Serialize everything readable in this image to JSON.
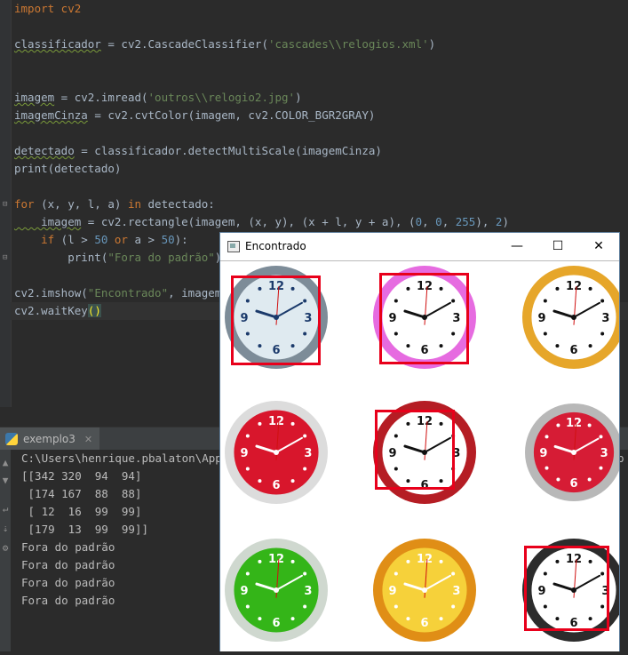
{
  "editor": {
    "line_import": "import cv2",
    "line_classifier_a": "classificador",
    "line_classifier_b": " = cv2.CascadeClassifier(",
    "line_classifier_str": "'cascades\\\\relogios.xml'",
    "line_classifier_c": ")",
    "line_imagem_a": "imagem",
    "line_imagem_b": " = cv2.imread(",
    "line_imagem_str": "'outros\\\\relogio2.jpg'",
    "line_imagem_c": ")",
    "line_cinza_a": "imagemCinza",
    "line_cinza_b": " = cv2.cvtColor(imagem, cv2.COLOR_BGR2GRAY)",
    "line_detect_a": "detectado",
    "line_detect_b": " = classificador.detectMultiScale(imagemCinza)",
    "line_print": "print(detectado)",
    "line_for_kw": "for",
    "line_for_b": " (x, y, l, a) ",
    "line_for_in": "in",
    "line_for_c": " detectado:",
    "line_rect_a": "    imagem",
    "line_rect_b": " = cv2.rectangle(imagem, (x, y), (x + l, y + a), (",
    "line_rect_n1": "0",
    "line_rect_sep1": ", ",
    "line_rect_n2": "0",
    "line_rect_sep2": ", ",
    "line_rect_n3": "255",
    "line_rect_c": "), ",
    "line_rect_n4": "2",
    "line_rect_d": ")",
    "line_if_kw": "    if",
    "line_if_b": " (l > ",
    "line_if_n1": "50",
    "line_if_or": " or ",
    "line_if_c": "a > ",
    "line_if_n2": "50",
    "line_if_d": "):",
    "line_print2_a": "        print(",
    "line_print2_str": "\"Fora do padrão\"",
    "line_print2_b": ")",
    "line_imshow_a": "cv2.imshow(",
    "line_imshow_str": "\"Encontrado\"",
    "line_imshow_b": ", imagem)",
    "line_wait_a": "cv2.waitKey",
    "line_wait_b": "()"
  },
  "run_panel": {
    "tab_label": "exemplo3",
    "output": [
      "C:\\Users\\henrique.pbalaton\\AppDa",
      "[[342 320  94  94]",
      " [174 167  88  88]",
      " [ 12  16  99  99]",
      " [179  13  99  99]]",
      "Fora do padrão",
      "Fora do padrão",
      "Fora do padrão",
      "Fora do padrão"
    ],
    "overflow_char": "p"
  },
  "window": {
    "title": "Encontrado",
    "minimize_glyph": "—",
    "maximize_glyph": "☐",
    "close_glyph": "✕"
  },
  "clocks": [
    {
      "face": "#dfeaf0",
      "rim": "#7d8c98",
      "accent": "#1b3a6b",
      "nums": [
        "12",
        "3",
        "6",
        "9"
      ]
    },
    {
      "face": "#ffffff",
      "rim": "#e66be0",
      "accent": "#111111",
      "nums": [
        "12",
        "3",
        "6",
        "9"
      ]
    },
    {
      "face": "#ffffff",
      "rim": "#e6a62a",
      "accent": "#111111",
      "nums": [
        "12",
        "3",
        "6",
        "9"
      ]
    },
    {
      "face": "#d8162c",
      "rim": "#dcdcdc",
      "accent": "#ffffff",
      "nums": [
        "12",
        "3",
        "6",
        "9"
      ]
    },
    {
      "face": "#ffffff",
      "rim": "#b51d24",
      "accent": "#111111",
      "nums": [
        "12",
        "3",
        "6",
        "9"
      ]
    },
    {
      "face": "#d61c35",
      "rim": "#b8b8b8",
      "accent": "#ffffff",
      "nums": [
        "12",
        "3",
        "6",
        "9"
      ]
    },
    {
      "face": "#34b518",
      "rim": "#cfd8cf",
      "accent": "#ffffff",
      "nums": [
        "12",
        "3",
        "6",
        "9"
      ]
    },
    {
      "face": "#f6d13a",
      "rim": "#e08e16",
      "accent": "#ffffff",
      "nums": [
        "12",
        "3",
        "6",
        "9"
      ]
    },
    {
      "face": "#ffffff",
      "rim": "#2c2c2c",
      "accent": "#111111",
      "nums": [
        "12",
        "3",
        "6",
        "9"
      ]
    }
  ],
  "colors": {
    "detection_box": "#e8001b",
    "editor_bg": "#2b2b2b",
    "keyword": "#cc7832",
    "string": "#6a8759"
  }
}
